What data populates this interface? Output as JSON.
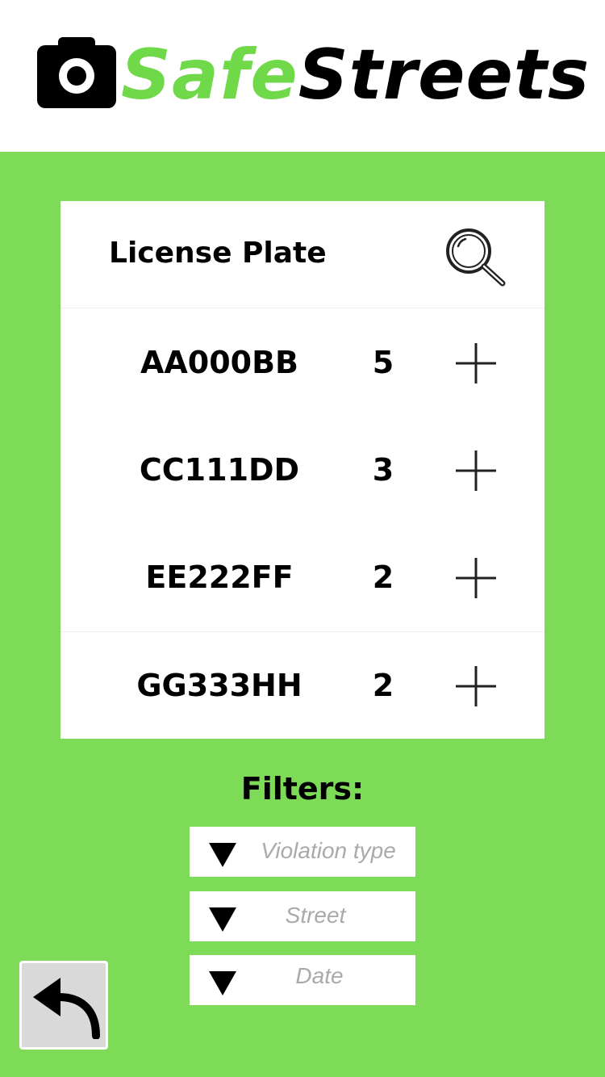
{
  "header": {
    "logo_part1": "Safe",
    "logo_part2": "Streets"
  },
  "table": {
    "title": "License Plate",
    "rows": [
      {
        "plate": "AA000BB",
        "count": "5"
      },
      {
        "plate": "CC111DD",
        "count": "3"
      },
      {
        "plate": "EE222FF",
        "count": "2"
      },
      {
        "plate": "GG333HH",
        "count": "2"
      }
    ]
  },
  "filters": {
    "label": "Filters:",
    "items": [
      {
        "placeholder": "Violation type"
      },
      {
        "placeholder": "Street"
      },
      {
        "placeholder": "Date"
      }
    ]
  },
  "icons": {
    "logo": "camera-icon",
    "search": "search-icon",
    "add": "plus-icon",
    "dropdown": "triangle-down-icon",
    "back": "back-arrow-icon"
  },
  "colors": {
    "background": "#7edb57",
    "brand_green": "#6fd94a",
    "card": "#ffffff",
    "placeholder_text": "#aaaaaa",
    "back_button": "#d9d9d9"
  }
}
